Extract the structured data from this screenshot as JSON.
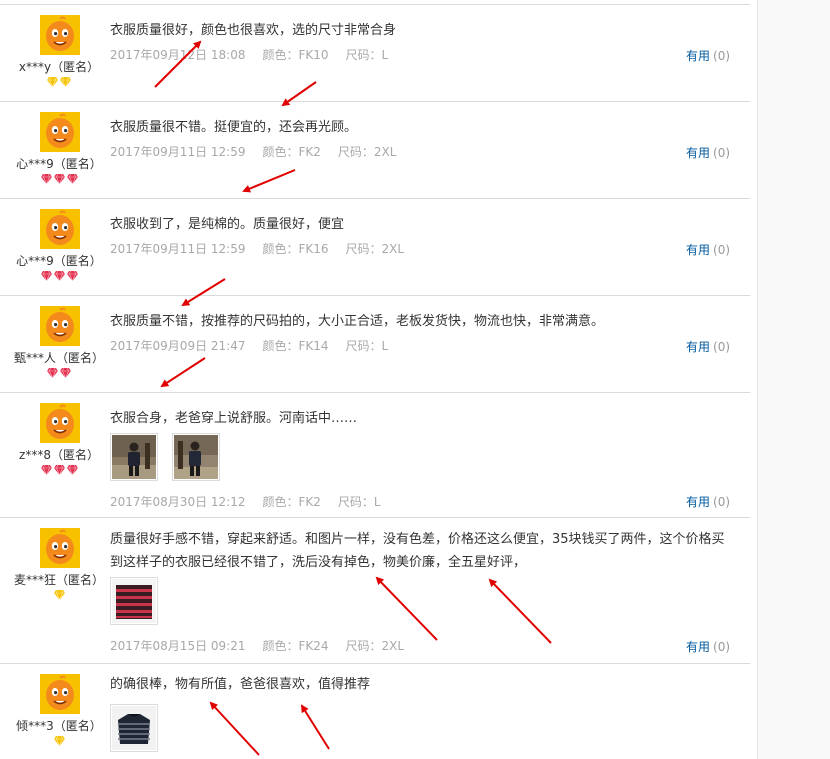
{
  "colors": {
    "arrow": "#e00000",
    "helpful_link": "#005aa0",
    "meta_text": "#a8a8a8",
    "avatar_orange": "#f38a1b",
    "gold_diamond": "#f5c200",
    "red_diamond": "#e3304f"
  },
  "reviews": [
    {
      "user": "x***y（匿名）",
      "level_icon": "gold-diamond-icon",
      "level_count": 2,
      "content": "衣服质量很好，颜色也很喜欢，选的尺寸非常合身",
      "date": "2017年09月12日 18:08",
      "color": "颜色：FK10",
      "size": "尺码：L",
      "helpful_label": "有用",
      "helpful_count": "(0)",
      "images": []
    },
    {
      "user": "心***9（匿名）",
      "level_icon": "red-diamond-icon",
      "level_count": 3,
      "content": "衣服质量很不错。挺便宜的，还会再光顾。",
      "date": "2017年09月11日 12:59",
      "color": "颜色：FK2",
      "size": "尺码：2XL",
      "helpful_label": "有用",
      "helpful_count": "(0)",
      "images": []
    },
    {
      "user": "心***9（匿名）",
      "level_icon": "red-diamond-icon",
      "level_count": 3,
      "content": "衣服收到了，是纯棉的。质量很好，便宜",
      "date": "2017年09月11日 12:59",
      "color": "颜色：FK16",
      "size": "尺码：2XL",
      "helpful_label": "有用",
      "helpful_count": "(0)",
      "images": []
    },
    {
      "user": "甄***人（匿名）",
      "level_icon": "red-diamond-icon",
      "level_count": 2,
      "content": "衣服质量不错，按推荐的尺码拍的，大小正合适，老板发货快，物流也快，非常满意。",
      "date": "2017年09月09日 21:47",
      "color": "颜色：FK14",
      "size": "尺码：L",
      "helpful_label": "有用",
      "helpful_count": "(0)",
      "images": []
    },
    {
      "user": "z***8（匿名）",
      "level_icon": "red-diamond-icon",
      "level_count": 3,
      "content": "衣服合身，老爸穿上说舒服。河南话中……",
      "date": "2017年08月30日 12:12",
      "color": "颜色：FK2",
      "size": "尺码：L",
      "helpful_label": "有用",
      "helpful_count": "(0)",
      "images": [
        "person-photo",
        "person-photo"
      ]
    },
    {
      "user": "麦***狂（匿名）",
      "level_icon": "gold-diamond-icon",
      "level_count": 1,
      "content": "质量很好手感不错，穿起来舒适。和图片一样，没有色差，价格还这么便宜，35块钱买了两件，这个价格买到这样子的衣服已经很不错了，洗后没有掉色，物美价廉，全五星好评，",
      "date": "2017年08月15日 09:21",
      "color": "颜色：FK24",
      "size": "尺码：2XL",
      "helpful_label": "有用",
      "helpful_count": "(0)",
      "images": [
        "striped-shirt-photo"
      ]
    },
    {
      "user": "倾***3（匿名）",
      "level_icon": "gold-diamond-icon",
      "level_count": 1,
      "content": "的确很棒，物有所值，爸爸很喜欢，值得推荐",
      "date": "",
      "color": "",
      "size": "",
      "helpful_label": "",
      "helpful_count": "",
      "images": [
        "sweater-photo"
      ]
    }
  ]
}
